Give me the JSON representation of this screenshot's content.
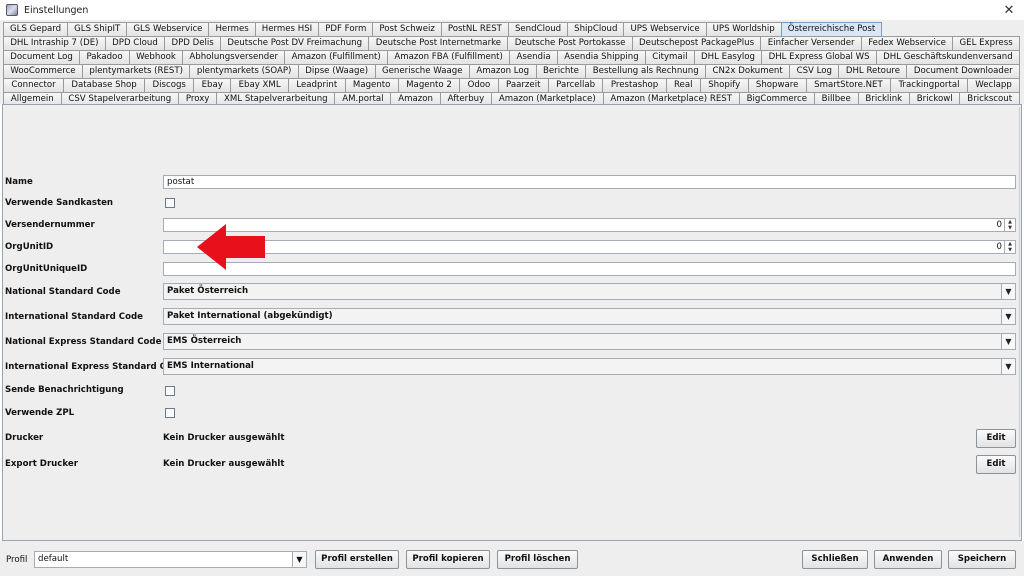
{
  "window": {
    "title": "Einstellungen",
    "close_glyph": "✕"
  },
  "tabs": {
    "row1": [
      "GLS Gepard",
      "GLS ShipIT",
      "GLS Webservice",
      "Hermes",
      "Hermes HSI",
      "PDF Form",
      "Post Schweiz",
      "PostNL REST",
      "SendCloud",
      "ShipCloud",
      "UPS Webservice",
      "UPS Worldship",
      "Österreichische Post"
    ],
    "row2": [
      "DHL Intraship 7 (DE)",
      "DPD Cloud",
      "DPD Delis",
      "Deutsche Post DV Freimachung",
      "Deutsche Post Internetmarke",
      "Deutsche Post Portokasse",
      "Deutschepost PackagePlus",
      "Einfacher Versender",
      "Fedex Webservice",
      "GEL Express"
    ],
    "row3": [
      "Document Log",
      "Pakadoo",
      "Webhook",
      "Abholungsversender",
      "Amazon (Fulfillment)",
      "Amazon FBA (Fulfillment)",
      "Asendia",
      "Asendia Shipping",
      "Citymail",
      "DHL Easylog",
      "DHL Express Global WS",
      "DHL Geschäftskundenversand"
    ],
    "row4": [
      "WooCommerce",
      "plentymarkets (REST)",
      "plentymarkets (SOAP)",
      "Dipse (Waage)",
      "Generische Waage",
      "Amazon Log",
      "Berichte",
      "Bestellung als Rechnung",
      "CN2x Dokument",
      "CSV Log",
      "DHL Retoure",
      "Document Downloader"
    ],
    "row5": [
      "Connector",
      "Database Shop",
      "Discogs",
      "Ebay",
      "Ebay XML",
      "Leadprint",
      "Magento",
      "Magento 2",
      "Odoo",
      "Paarzeit",
      "Parcellab",
      "Prestashop",
      "Real",
      "Shopify",
      "Shopware",
      "SmartStore.NET",
      "Trackingportal",
      "Weclapp"
    ],
    "row6": [
      "Allgemein",
      "CSV Stapelverarbeitung",
      "Proxy",
      "XML Stapelverarbeitung",
      "AM.portal",
      "Amazon",
      "Afterbuy",
      "Amazon (Marketplace)",
      "Amazon (Marketplace) REST",
      "BigCommerce",
      "Billbee",
      "Bricklink",
      "Brickowl",
      "Brickscout"
    ],
    "selected": "Österreichische Post"
  },
  "form": {
    "name": {
      "label": "Name",
      "value": "postat"
    },
    "sandbox": {
      "label": "Verwende Sandkasten",
      "checked": false
    },
    "versendernummer": {
      "label": "Versendernummer",
      "value": "0"
    },
    "orgunitid": {
      "label": "OrgUnitID",
      "value": "0"
    },
    "orgunituniqueid": {
      "label": "OrgUnitUniqueID",
      "value": ""
    },
    "national_standard": {
      "label": "National Standard Code",
      "value": "Paket Österreich"
    },
    "international_standard": {
      "label": "International Standard Code",
      "value": "Paket International (abgekündigt)"
    },
    "national_express": {
      "label": "National Express Standard Code",
      "value": "EMS Österreich"
    },
    "international_express": {
      "label": "International Express Standard Code",
      "value": "EMS International"
    },
    "notify": {
      "label": "Sende Benachrichtigung",
      "checked": false
    },
    "zpl": {
      "label": "Verwende ZPL",
      "checked": false
    },
    "drucker": {
      "label": "Drucker",
      "value": "Kein Drucker ausgewählt",
      "button": "Edit"
    },
    "export_drucker": {
      "label": "Export Drucker",
      "value": "Kein Drucker ausgewählt",
      "button": "Edit"
    }
  },
  "annotation": {
    "color": "#e8101a",
    "icon": "red-arrow-left-icon"
  },
  "footer": {
    "profil_label": "Profil",
    "profil_value": "default",
    "buttons": {
      "create": "Profil erstellen",
      "copy": "Profil kopieren",
      "delete": "Profil löschen",
      "close": "Schließen",
      "apply": "Anwenden",
      "save": "Speichern"
    }
  }
}
